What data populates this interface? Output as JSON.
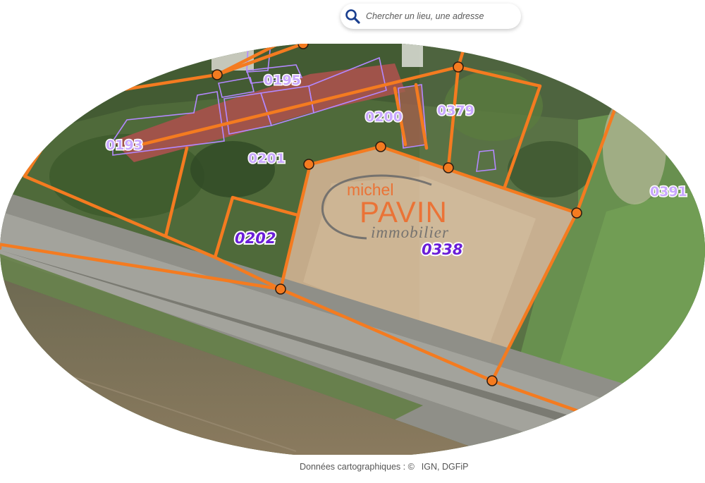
{
  "search": {
    "placeholder": "Chercher un lieu, une adresse"
  },
  "icons": {
    "search": "search-icon"
  },
  "colors": {
    "parcel_boundary": "#f47b20",
    "building_outline": "#b388ff",
    "parcel_label": "#c9a8ff",
    "parcel_label_highlight": "#6a1ed8",
    "watermark_brand": "#ef6a2a",
    "watermark_tagline": "#6b6b6b"
  },
  "map": {
    "parcels": [
      {
        "id": "0195",
        "highlighted": false
      },
      {
        "id": "0193",
        "highlighted": false
      },
      {
        "id": "0200",
        "highlighted": false
      },
      {
        "id": "0379",
        "highlighted": false
      },
      {
        "id": "0201",
        "highlighted": false
      },
      {
        "id": "0391",
        "highlighted": false
      },
      {
        "id": "0202",
        "highlighted": true
      },
      {
        "id": "0338",
        "highlighted": true
      }
    ],
    "watermark": {
      "word1": "michel",
      "word2": "PAVIN",
      "word3": "immobilier"
    }
  },
  "footer": {
    "attribution_label": "Données cartographiques : ©",
    "attribution_source": "IGN, DGFiP"
  }
}
